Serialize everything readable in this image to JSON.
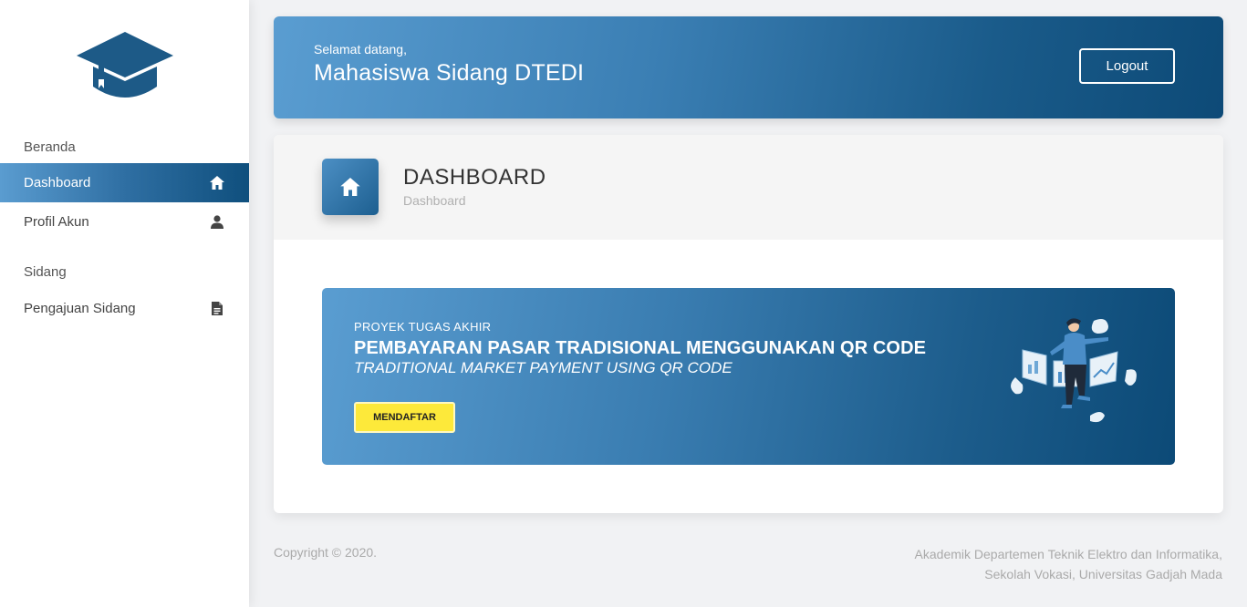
{
  "sidebar": {
    "logo_icon": "graduation-cap-icon",
    "sections": [
      {
        "heading": "Beranda"
      },
      {
        "heading": "Sidang"
      }
    ],
    "items": [
      {
        "label": "Dashboard",
        "icon": "home-icon",
        "active": true
      },
      {
        "label": "Profil Akun",
        "icon": "user-icon",
        "active": false
      },
      {
        "label": "Pengajuan Sidang",
        "icon": "document-icon",
        "active": false
      }
    ]
  },
  "header": {
    "greeting": "Selamat datang,",
    "user_name": "Mahasiswa Sidang DTEDI",
    "logout_label": "Logout"
  },
  "page": {
    "title": "DASHBOARD",
    "breadcrumb": "Dashboard",
    "icon": "home-icon"
  },
  "project": {
    "label": "PROYEK TUGAS AKHIR",
    "title": "PEMBAYARAN PASAR TRADISIONAL MENGGUNAKAN QR CODE",
    "title_en": "TRADITIONAL MARKET PAYMENT USING QR CODE",
    "register_label": "MENDAFTAR"
  },
  "footer": {
    "copyright": "Copyright © 2020.",
    "org_line1": "Akademik Departemen Teknik Elektro dan Informatika,",
    "org_line2": "Sekolah Vokasi, Universitas Gadjah Mada"
  },
  "colors": {
    "primary_dark": "#0d4a77",
    "primary_light": "#5a9dd1",
    "accent_yellow": "#fde93a"
  }
}
